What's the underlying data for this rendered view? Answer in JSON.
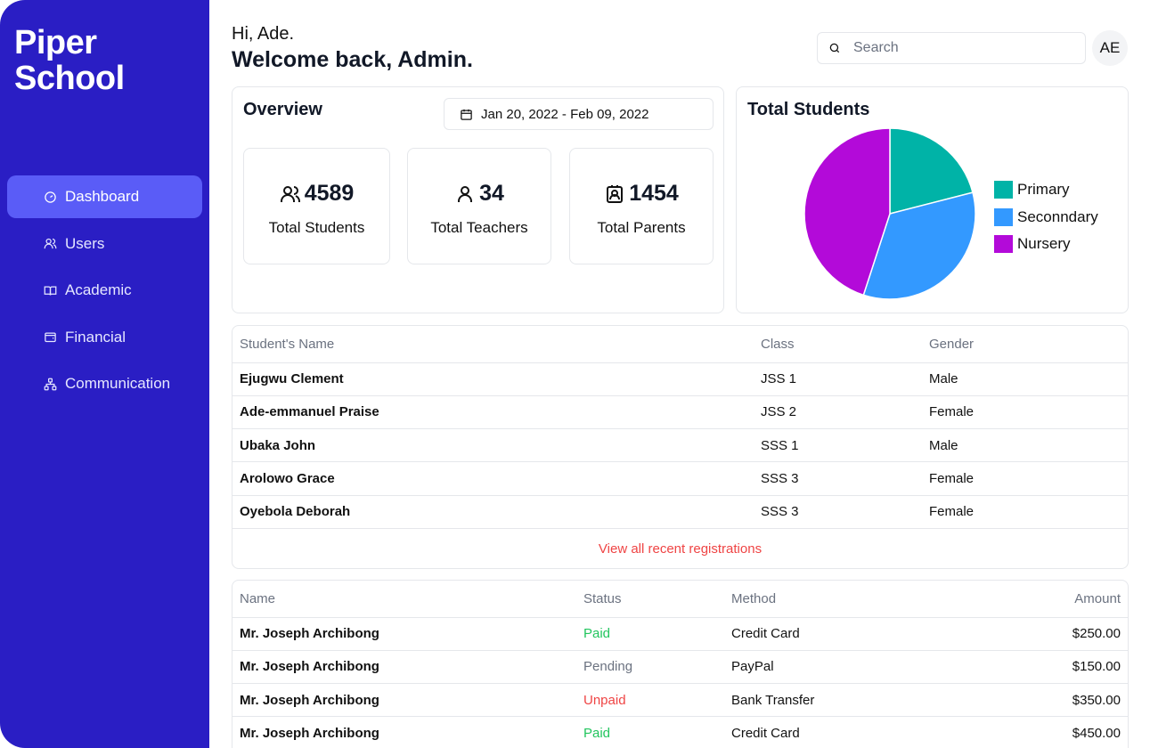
{
  "brand": {
    "line1": "Piper",
    "line2": "School"
  },
  "nav": [
    {
      "label": "Dashboard",
      "icon": "gauge-icon",
      "active": true
    },
    {
      "label": "Users",
      "icon": "users-icon"
    },
    {
      "label": "Academic",
      "icon": "book-icon"
    },
    {
      "label": "Financial",
      "icon": "wallet-icon"
    },
    {
      "label": "Communication",
      "icon": "network-icon"
    }
  ],
  "header": {
    "greeting": "Hi, Ade.",
    "welcome": "Welcome back, Admin."
  },
  "search": {
    "placeholder": "Search"
  },
  "avatar": {
    "initials": "AE"
  },
  "overview": {
    "title": "Overview",
    "date_range": "Jan 20, 2022 - Feb 09, 2022",
    "stats": [
      {
        "value": "4589",
        "label": "Total Students",
        "icon": "users-icon"
      },
      {
        "value": "34",
        "label": "Total Teachers",
        "icon": "user-icon"
      },
      {
        "value": "1454",
        "label": "Total Parents",
        "icon": "contact-icon"
      }
    ]
  },
  "total_students": {
    "title": "Total Students",
    "colors": {
      "Primary": "#00b3a7",
      "Seconndary": "#3399ff",
      "Nursery": "#b30ad9"
    }
  },
  "chart_data": {
    "type": "pie",
    "title": "Total Students",
    "categories": [
      "Primary",
      "Seconndary",
      "Nursery"
    ],
    "values": [
      21,
      34,
      45
    ],
    "legend": "right"
  },
  "registrations": {
    "columns": [
      "Student's Name",
      "Class",
      "Gender"
    ],
    "rows": [
      [
        "Ejugwu Clement",
        "JSS 1",
        "Male"
      ],
      [
        "Ade-emmanuel Praise",
        "JSS 2",
        "Female"
      ],
      [
        "Ubaka John",
        "SSS 1",
        "Male"
      ],
      [
        "Arolowo Grace",
        "SSS 3",
        "Female"
      ],
      [
        "Oyebola Deborah",
        "SSS 3",
        "Female"
      ]
    ],
    "view_all": "View all recent registrations"
  },
  "payments": {
    "columns": [
      "Name",
      "Status",
      "Method",
      "Amount"
    ],
    "status_colors": {
      "Paid": "#22c55e",
      "Pending": "#6b7280",
      "Unpaid": "#ef4444"
    },
    "rows": [
      [
        "Mr. Joseph Archibong",
        "Paid",
        "Credit Card",
        "$250.00"
      ],
      [
        "Mr. Joseph Archibong",
        "Pending",
        "PayPal",
        "$150.00"
      ],
      [
        "Mr. Joseph Archibong",
        "Unpaid",
        "Bank Transfer",
        "$350.00"
      ],
      [
        "Mr. Joseph Archibong",
        "Paid",
        "Credit Card",
        "$450.00"
      ]
    ]
  }
}
